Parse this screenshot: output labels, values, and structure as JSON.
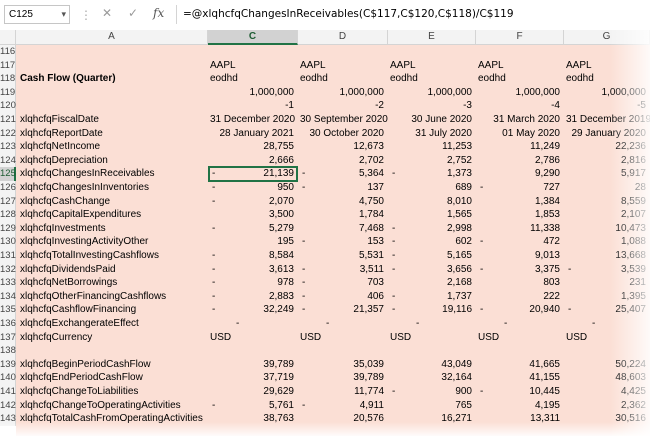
{
  "formula_bar": {
    "name_box": "C125",
    "formula": "=@xlqhcfqChangesInReceivables(C$117,C$120,C$118)/C$119",
    "cancel_icon": "✕",
    "enter_icon": "✓",
    "fx_icon": "fx"
  },
  "columns": [
    "A",
    "C",
    "D",
    "E",
    "F",
    "G"
  ],
  "rows": [
    {
      "n": "116",
      "a": "",
      "v": [
        "",
        "",
        "",
        "",
        ""
      ]
    },
    {
      "n": "117",
      "a": "",
      "v": [
        "AAPL",
        "AAPL",
        "AAPL",
        "AAPL",
        "AAPL"
      ]
    },
    {
      "n": "118",
      "a": "Cash Flow (Quarter)",
      "v": [
        "eodhd",
        "eodhd",
        "eodhd",
        "eodhd",
        "eodhd"
      ]
    },
    {
      "n": "119",
      "a": "",
      "v": [
        "1,000,000",
        "1,000,000",
        "1,000,000",
        "1,000,000",
        "1,000,000"
      ]
    },
    {
      "n": "120",
      "a": "",
      "v": [
        "-1",
        "-2",
        "-3",
        "-4",
        "-5"
      ]
    },
    {
      "n": "121",
      "a": "xlqhcfqFiscalDate",
      "v": [
        "31 December 2020",
        "30 September 2020",
        "30 June 2020",
        "31 March 2020",
        "31 December 2019"
      ]
    },
    {
      "n": "122",
      "a": "xlqhcfqReportDate",
      "v": [
        "28 January 2021",
        "30 October 2020",
        "31 July 2020",
        "01 May 2020",
        "29 January 2020"
      ]
    },
    {
      "n": "123",
      "a": "xlqhcfqNetIncome",
      "v": [
        "28,755",
        "12,673",
        "11,253",
        "11,249",
        "22,236"
      ]
    },
    {
      "n": "124",
      "a": "xlqhcfqDepreciation",
      "v": [
        "2,666",
        "2,702",
        "2,752",
        "2,786",
        "2,816"
      ]
    },
    {
      "n": "125",
      "a": "xlqhcfqChangesInReceivables",
      "v": [
        "21,139",
        "5,364",
        "1,373",
        "9,290",
        "5,917"
      ],
      "neg": [
        true,
        true,
        true,
        false,
        false
      ]
    },
    {
      "n": "126",
      "a": "xlqhcfqChangesInInventories",
      "v": [
        "950",
        "137",
        "689",
        "727",
        "28"
      ],
      "neg": [
        true,
        true,
        false,
        true,
        false
      ]
    },
    {
      "n": "127",
      "a": "xlqhcfqCashChange",
      "v": [
        "2,070",
        "4,750",
        "8,010",
        "1,384",
        "8,559"
      ],
      "neg": [
        true,
        false,
        false,
        false,
        false
      ]
    },
    {
      "n": "128",
      "a": "xlqhcfqCapitalExpenditures",
      "v": [
        "3,500",
        "1,784",
        "1,565",
        "1,853",
        "2,107"
      ]
    },
    {
      "n": "129",
      "a": "xlqhcfqInvestments",
      "v": [
        "5,279",
        "7,468",
        "2,998",
        "11,338",
        "10,473"
      ],
      "neg": [
        true,
        false,
        true,
        false,
        false
      ]
    },
    {
      "n": "130",
      "a": "xlqhcfqInvestingActivityOther",
      "v": [
        "195",
        "153",
        "602",
        "472",
        "1,088"
      ],
      "neg": [
        false,
        true,
        true,
        true,
        false
      ]
    },
    {
      "n": "131",
      "a": "xlqhcfqTotalInvestingCashflows",
      "v": [
        "8,584",
        "5,531",
        "5,165",
        "9,013",
        "13,668"
      ],
      "neg": [
        true,
        false,
        true,
        false,
        false
      ]
    },
    {
      "n": "132",
      "a": "xlqhcfqDividendsPaid",
      "v": [
        "3,613",
        "3,511",
        "3,656",
        "3,375",
        "3,539"
      ],
      "neg": [
        true,
        true,
        true,
        true,
        true
      ]
    },
    {
      "n": "133",
      "a": "xlqhcfqNetBorrowings",
      "v": [
        "978",
        "703",
        "2,168",
        "803",
        "231"
      ],
      "neg": [
        true,
        true,
        false,
        false,
        false
      ]
    },
    {
      "n": "134",
      "a": "xlqhcfqOtherFinancingCashflows",
      "v": [
        "2,883",
        "406",
        "1,737",
        "222",
        "1,395"
      ],
      "neg": [
        true,
        true,
        true,
        false,
        false
      ]
    },
    {
      "n": "135",
      "a": "xlqhcfqCashflowFinancing",
      "v": [
        "32,249",
        "21,357",
        "19,116",
        "20,940",
        "25,407"
      ],
      "neg": [
        true,
        true,
        true,
        true,
        true
      ]
    },
    {
      "n": "136",
      "a": "xlqhcfqExchangerateEffect",
      "v": [
        "-",
        "-",
        "-",
        "-",
        "-"
      ]
    },
    {
      "n": "137",
      "a": "xlqhcfqCurrency",
      "v": [
        "USD",
        "USD",
        "USD",
        "USD",
        "USD"
      ]
    },
    {
      "n": "138",
      "a": "",
      "v": [
        "",
        "",
        "",
        "",
        ""
      ]
    },
    {
      "n": "139",
      "a": "xlqhcfqBeginPeriodCashFlow",
      "v": [
        "39,789",
        "35,039",
        "43,049",
        "41,665",
        "50,224"
      ]
    },
    {
      "n": "140",
      "a": "xlqhcfqEndPeriodCashFlow",
      "v": [
        "37,719",
        "39,789",
        "32,164",
        "41,155",
        "48,603"
      ]
    },
    {
      "n": "141",
      "a": "xlqhcfqChangeToLiabilities",
      "v": [
        "29,629",
        "11,774",
        "900",
        "10,445",
        "4,425"
      ],
      "neg": [
        false,
        false,
        true,
        true,
        false
      ]
    },
    {
      "n": "142",
      "a": "xlqhcfqChangeToOperatingActivities",
      "v": [
        "5,761",
        "4,911",
        "765",
        "4,195",
        "2,362"
      ],
      "neg": [
        true,
        true,
        false,
        false,
        false
      ]
    },
    {
      "n": "143",
      "a": "xlqhcfqTotalCashFromOperatingActivities",
      "v": [
        "38,763",
        "20,576",
        "16,271",
        "13,311",
        "30,516"
      ]
    }
  ]
}
